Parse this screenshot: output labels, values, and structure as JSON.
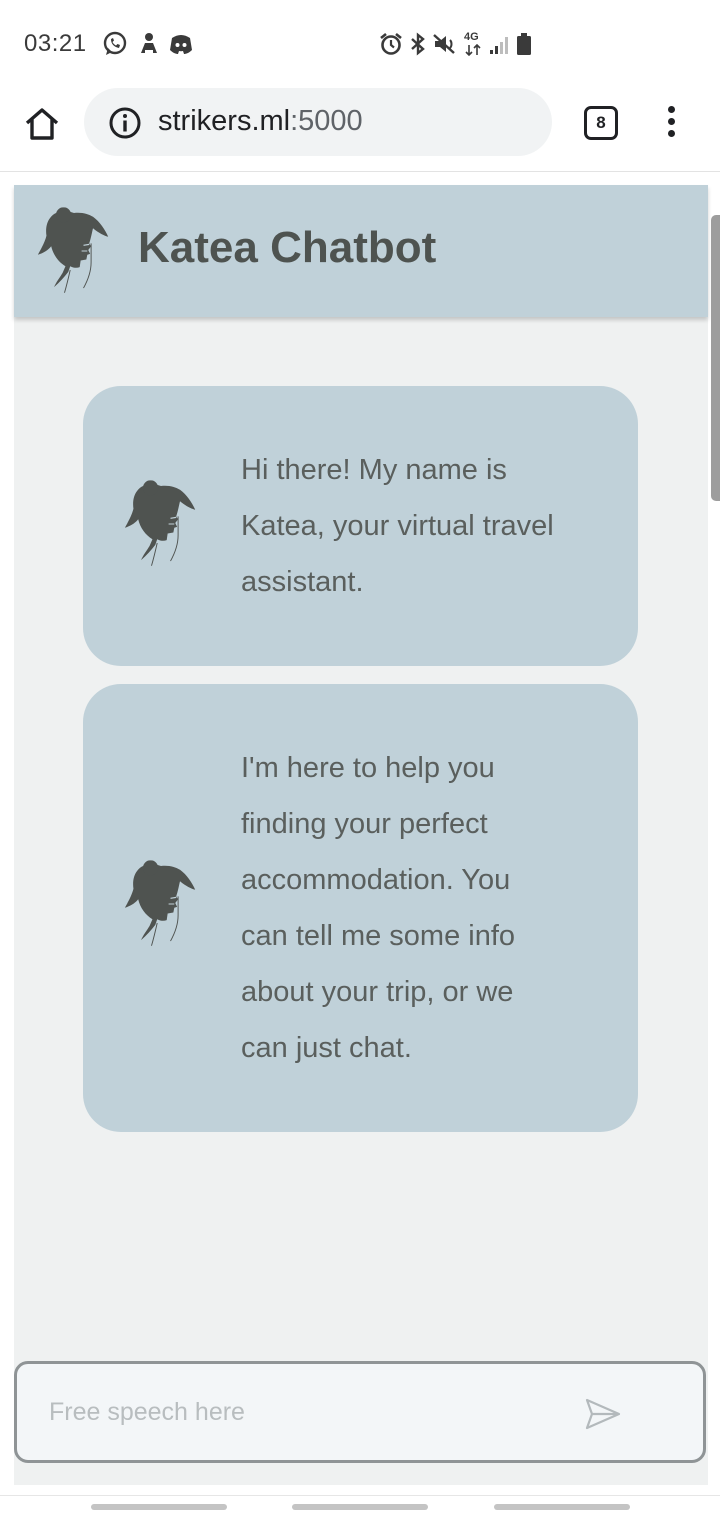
{
  "status_bar": {
    "time": "03:21",
    "left_icons": [
      "whatsapp-icon",
      "notification-app-icon",
      "discord-icon"
    ],
    "right_icons": [
      "alarm-icon",
      "bluetooth-icon",
      "mute-icon",
      "4g-data-icon",
      "signal-icon",
      "battery-icon"
    ],
    "network_label": "4G"
  },
  "browser": {
    "url_host": "strikers.ml",
    "url_port": ":5000",
    "tab_count": "8",
    "icons": [
      "home-icon",
      "info-icon",
      "tabs-icon",
      "more-vert-icon"
    ]
  },
  "chat": {
    "title": "Katea Chatbot",
    "avatar_icon": "woman-profile-icon",
    "messages": [
      {
        "sender": "bot",
        "text": "Hi there! My name is Katea, your virtual travel assistant."
      },
      {
        "sender": "bot",
        "text": "I'm here to help you finding your perfect accommodation. You can tell me some info about your trip, or we can just chat."
      }
    ],
    "input": {
      "placeholder": "Free speech here",
      "value": "",
      "send_icon": "send-icon"
    }
  },
  "colors": {
    "header_bg": "#c0d1d9",
    "bubble_bg": "#c0d1d9",
    "panel_bg": "#eff1f1",
    "title_text": "#4e5350",
    "message_text": "#5a5f5d"
  }
}
